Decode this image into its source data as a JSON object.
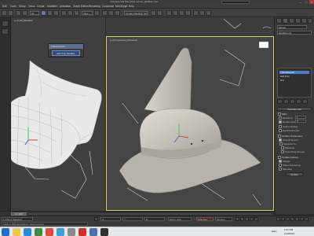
{
  "window": {
    "title": "Autodesk 3ds Max 2016   helmet_gladiator.max"
  },
  "menu": {
    "items": [
      "Edit",
      "Tools",
      "Group",
      "Views",
      "Create",
      "Modifiers",
      "Animation",
      "Graph Editors",
      "Rendering",
      "Customize",
      "MAXScript",
      "Help"
    ]
  },
  "toolbar": {
    "selection_filter": "All",
    "view_dropdown": "View",
    "named_set": "Create Selection Se"
  },
  "viewports": {
    "left_label": "[+] [Left] [Shaded]",
    "main_label": "[+] [Perspective] [Shaded]"
  },
  "dialog": {
    "title": "Turbosmooth",
    "button_label": "Edit Poly Modifier"
  },
  "command_panel": {
    "object_name": "helmet",
    "modifier_list": "Modifier List",
    "stack": [
      "TurboSmooth",
      "Edit Poly",
      "Box"
    ],
    "rollout_title": "TurboSmooth",
    "main_label": "Main",
    "iterations_label": "Iterations:",
    "iterations_value": "1",
    "render_iters_label": "Render Iters:",
    "render_iters_value": "0",
    "isoline_label": "Isoline Display",
    "explicit_label": "Explicit Normals",
    "surface_title": "Surface Parameters",
    "smooth_result_label": "Smooth Result",
    "separate_label": "Separate by:",
    "materials_label": "Materials",
    "smoothing_label": "Smoothing Groups",
    "update_title": "Update Options",
    "always_label": "Always",
    "when_rendering_label": "When Rendering",
    "manually_label": "Manually",
    "update_button": "Update"
  },
  "timeline": {
    "frame": "0 / 100"
  },
  "status": {
    "selected": "1 Object Selected",
    "prompt": "Click or click-and-drag to select objects",
    "x": "X: ",
    "y": "Y: ",
    "z": "Z: ",
    "grid": "Grid = 10.0",
    "auto_key": "Auto Key",
    "set_key": "Set Key"
  },
  "taskbar": {
    "time": "2:41 PM",
    "date": "11/3/2015",
    "lang": "ENG"
  },
  "colors": {
    "viewport_active_border": "#d8d25c",
    "selection_blue": "#4f7bbf",
    "mesh_wire": "#f2f2f2",
    "helmet_shaded": "#c9c6bd"
  }
}
